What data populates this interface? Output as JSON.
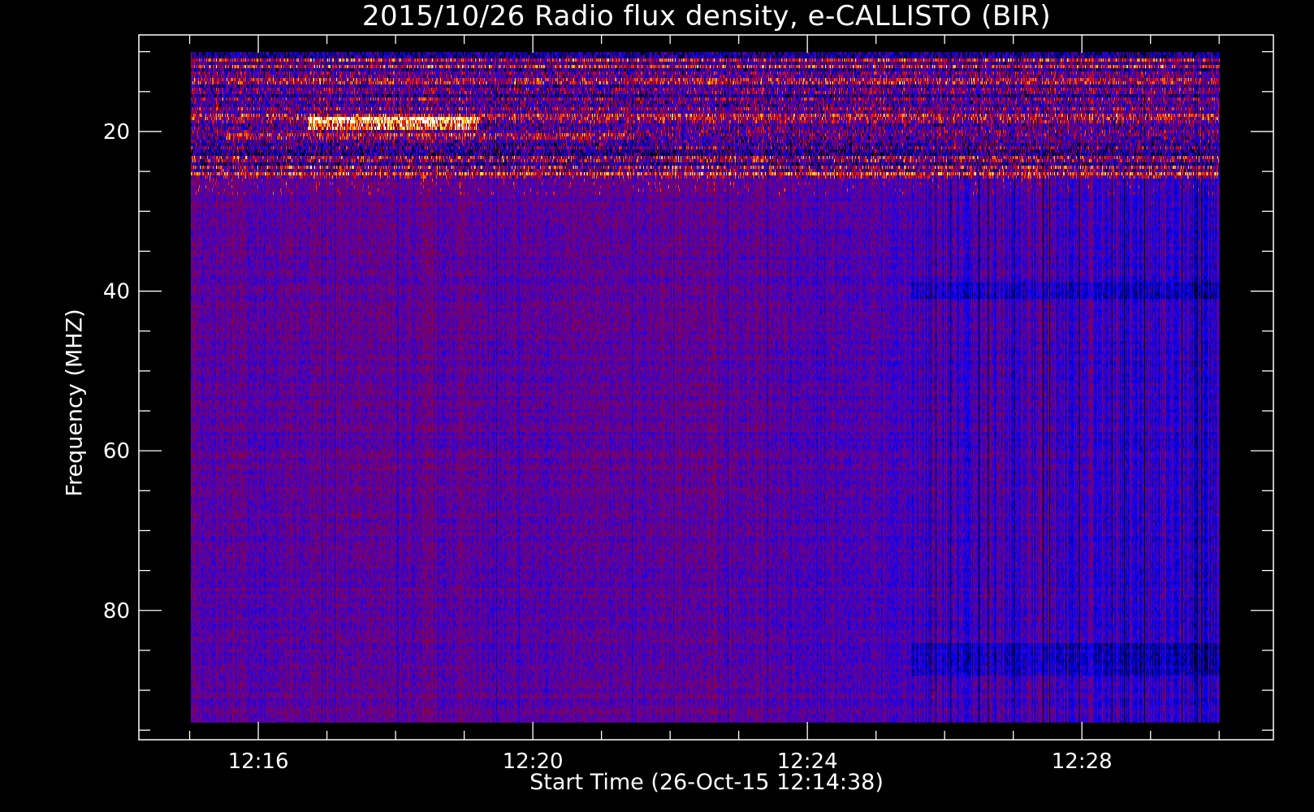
{
  "chart_data": {
    "type": "heatmap",
    "title": "2015/10/26  Radio flux density, e-CALLISTO (BIR)",
    "xlabel": "Start Time (26-Oct-15 12:14:38)",
    "ylabel": "Frequency (MHZ)",
    "x_unit": "minutes after 12:00 UT",
    "xlim": [
      14.26,
      30.79
    ],
    "data_xrange": [
      15.0,
      30.0
    ],
    "ylim": [
      96.2,
      7.9
    ],
    "data_yrange": [
      10,
      94
    ],
    "x_major_ticks": [
      {
        "value": 16,
        "label": "12:16"
      },
      {
        "value": 20,
        "label": "12:20"
      },
      {
        "value": 24,
        "label": "12:24"
      },
      {
        "value": 28,
        "label": "12:28"
      }
    ],
    "x_minor_step": 1,
    "y_major_ticks": [
      {
        "value": 20,
        "label": "20"
      },
      {
        "value": 40,
        "label": "40"
      },
      {
        "value": 60,
        "label": "60"
      },
      {
        "value": 80,
        "label": "80"
      }
    ],
    "y_minor_step": 5,
    "grid": false,
    "colormap": [
      "#000000",
      "#0000ff",
      "#64009a",
      "#96001e",
      "#ff1400",
      "#ff9600",
      "#ffff28",
      "#ffffff"
    ],
    "features": [
      {
        "name": "high-variance interference band",
        "freq_range": [
          10,
          26
        ],
        "time_range": [
          15,
          30
        ]
      },
      {
        "name": "bright emission",
        "freq_range": [
          18.5,
          19.5
        ],
        "time_range": [
          16.7,
          19.2
        ]
      },
      {
        "name": "quieter background",
        "freq_range": [
          26,
          94
        ],
        "time_range": [
          25.5,
          30
        ]
      }
    ]
  }
}
